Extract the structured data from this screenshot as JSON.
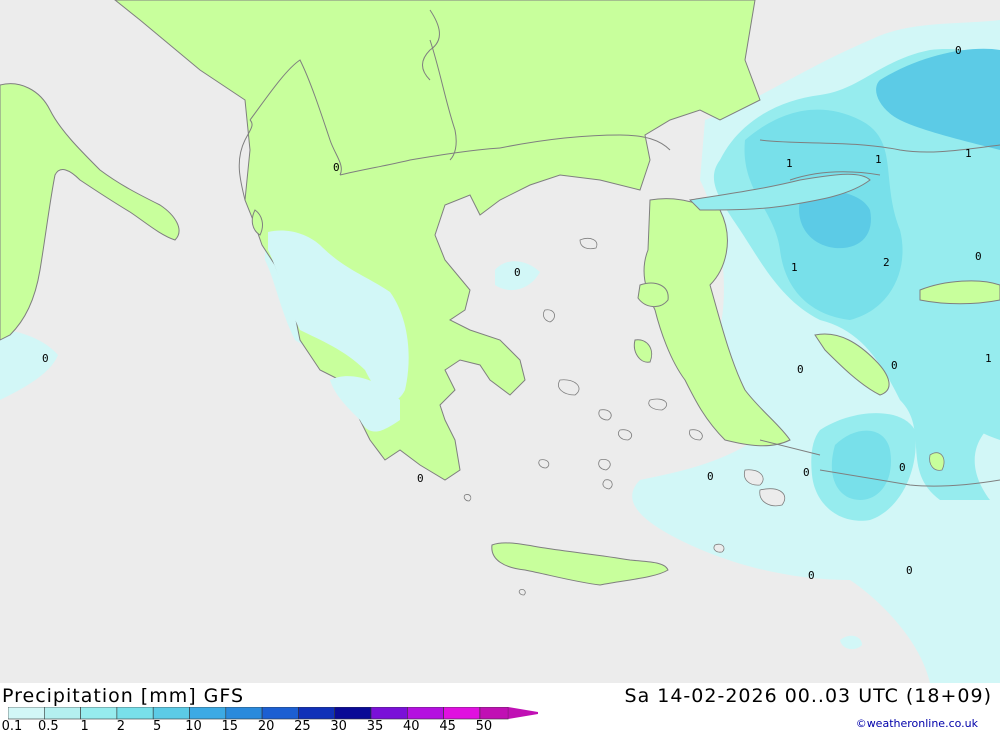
{
  "header": {
    "title": "Precipitation [mm] GFS",
    "datetime": "Sa 14-02-2026 00..03 UTC (18+09)",
    "credit": "©weatheronline.co.uk"
  },
  "legend": {
    "ticks": [
      "0.1",
      "0.5",
      "1",
      "2",
      "5",
      "10",
      "15",
      "20",
      "25",
      "30",
      "35",
      "40",
      "45",
      "50"
    ],
    "colors": [
      "#d2f7f7",
      "#b4f0f0",
      "#96ecee",
      "#78e0ea",
      "#5ccbe6",
      "#3caae4",
      "#2a8adc",
      "#1c5fd2",
      "#1030b8",
      "#0a0a96",
      "#7a10d8",
      "#b410e0",
      "#e010e0",
      "#c010b4"
    ]
  },
  "map": {
    "colors": {
      "sea": "#ececec",
      "land": "#c8ff9c",
      "precip_light": "#d2f7f7",
      "precip_mid": "#96ecee",
      "precip_heavy": "#5ccbe6",
      "border": "#787878"
    },
    "values": [
      {
        "id": "v-albania",
        "text": "0"
      },
      {
        "id": "v-italy",
        "text": "0"
      },
      {
        "id": "v-aegean",
        "text": "0"
      },
      {
        "id": "v-peloponnese",
        "text": "0"
      },
      {
        "id": "v-ne1",
        "text": "0"
      },
      {
        "id": "v-marmara1",
        "text": "1"
      },
      {
        "id": "v-marmara2",
        "text": "1"
      },
      {
        "id": "v-marmara3",
        "text": "1"
      },
      {
        "id": "v-east1",
        "text": "1"
      },
      {
        "id": "v-east2",
        "text": "2"
      },
      {
        "id": "v-east3",
        "text": "0"
      },
      {
        "id": "v-east4",
        "text": "0"
      },
      {
        "id": "v-east5",
        "text": "0"
      },
      {
        "id": "v-east6",
        "text": "1"
      },
      {
        "id": "v-dodec1",
        "text": "0"
      },
      {
        "id": "v-dodec2",
        "text": "0"
      },
      {
        "id": "v-dodec3",
        "text": "0"
      },
      {
        "id": "v-south1",
        "text": "0"
      },
      {
        "id": "v-south2",
        "text": "0"
      }
    ]
  }
}
